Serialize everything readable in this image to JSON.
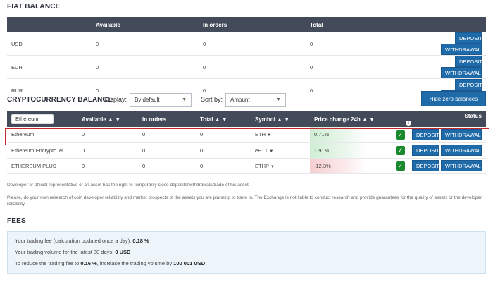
{
  "fiat": {
    "title": "FIAT BALANCE",
    "headers": [
      "",
      "Available",
      "In orders",
      "Total"
    ],
    "rows": [
      {
        "currency": "USD",
        "available": "0",
        "in_orders": "0",
        "total": "0"
      },
      {
        "currency": "EUR",
        "available": "0",
        "in_orders": "0",
        "total": "0"
      },
      {
        "currency": "RUR",
        "available": "0",
        "in_orders": "0",
        "total": "0"
      }
    ],
    "deposit_label": "DEPOSIT",
    "withdrawal_label": "WITHDRAWAL"
  },
  "crypto": {
    "title": "CRYPTOCURRENCY BALANCE",
    "display_label": "Display:",
    "display_value": "By default",
    "sort_label": "Sort by:",
    "sort_value": "Amount",
    "hide_zero_label": "Hide zero balances",
    "search_value": "Ethereum",
    "headers": {
      "available": "Available ▲ ▼",
      "in_orders": "In orders",
      "total": "Total ▲ ▼",
      "symbol": "Symbol ▲ ▼",
      "price_change": "Price change 24h ▲ ▼",
      "status": "Status"
    },
    "rows": [
      {
        "name": "Ethereum",
        "available": "0",
        "in_orders": "0",
        "total": "0",
        "symbol": "ETH",
        "change": "0.71%",
        "trend": "up"
      },
      {
        "name": "Ethereum EncryptoTel",
        "available": "0",
        "in_orders": "0",
        "total": "0",
        "symbol": "eETT",
        "change": "1.91%",
        "trend": "up"
      },
      {
        "name": "ETHEREUM PLUS",
        "available": "0",
        "in_orders": "0",
        "total": "0",
        "symbol": "ETHP",
        "change": "-12.3%",
        "trend": "down"
      }
    ],
    "deposit_label": "DEPOSIT",
    "withdrawal_label": "WITHDRAWAL",
    "highlight_color": "#c9262c"
  },
  "notes": {
    "line1": "Developer or official representative of an asset has the right to temporarily close deposits/withdrawals/trade of his asset.",
    "line2": "Please, do your own research of coin developer reliability and market prospects of the assets you are planning to trade in. The Exchange is not liable to conduct research and provide guarantees for the quality of assets or the developer reliability."
  },
  "fees": {
    "title": "FEES",
    "line1_text": "Your trading fee (calculation updated once a day): ",
    "line1_value": "0.18 %",
    "line2_text": "Your trading volume for the latest 30 days: ",
    "line2_value": "0 USD",
    "line3_text_a": "To reduce the trading fee to ",
    "line3_value_a": "0.16 %",
    "line3_text_b": ", increase the trading volume by ",
    "line3_value_b": "100 001 USD"
  },
  "colors": {
    "header_bg": "#434b5a",
    "button_bg": "#1f6aa9",
    "status_ok": "#1b8a2e",
    "change_up": "#cfeed3",
    "change_down": "#f6cfd0"
  }
}
